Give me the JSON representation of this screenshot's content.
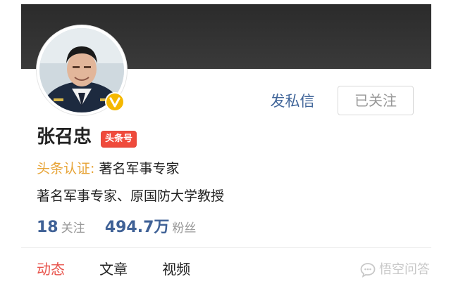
{
  "profile": {
    "name": "张召忠",
    "platform_badge": "头条号",
    "verified_icon": "v-badge-icon",
    "auth_label": "头条认证:",
    "auth_value": "著名军事专家",
    "description": "著名军事专家、原国防大学教授"
  },
  "actions": {
    "message_label": "发私信",
    "follow_label": "已关注"
  },
  "stats": {
    "following_count": "18",
    "following_label": "关注",
    "followers_count": "494.7万",
    "followers_label": "粉丝"
  },
  "tabs": [
    {
      "label": "动态",
      "active": true
    },
    {
      "label": "文章",
      "active": false
    },
    {
      "label": "视频",
      "active": false
    }
  ],
  "watermark": {
    "icon": "speech-bubble-icon",
    "text": "悟空问答"
  },
  "colors": {
    "accent_red": "#e8534b",
    "link_blue": "#406599",
    "auth_gold": "#e7a437",
    "badge_red": "#f04a3b",
    "cover_dark": "#2b2b2b"
  }
}
